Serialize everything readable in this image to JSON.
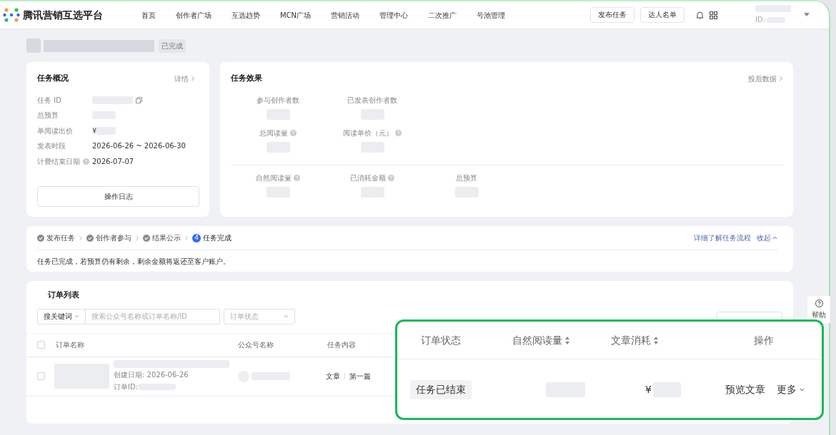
{
  "nav": {
    "logo": "腾讯营销互选平台",
    "items": [
      "首页",
      "创作者广场",
      "互选趋势",
      "MCN广场",
      "营销活动",
      "管理中心",
      "二次推广",
      "号池管理"
    ],
    "buttons": [
      "发布任务",
      "达人名单"
    ],
    "id_label": "ID:"
  },
  "page_header": {
    "status": "已完成"
  },
  "overview": {
    "title": "任务概况",
    "link": "详情",
    "rows": [
      {
        "label": "任务 ID",
        "kind": "id",
        "help": false
      },
      {
        "label": "总预算",
        "kind": "blurred",
        "help": false
      },
      {
        "label": "单阅读出价",
        "kind": "price",
        "symbol": "¥",
        "help": false
      },
      {
        "label": "发表时段",
        "kind": "text",
        "value": "2026-06-26 ~ 2026-06-30",
        "help": false
      },
      {
        "label": "计费结束日期",
        "kind": "text",
        "value": "2026-07-07",
        "help": true
      }
    ],
    "button": "操作日志"
  },
  "effect": {
    "title": "任务效果",
    "link": "投后数据",
    "groups": [
      [
        {
          "label": "参与创作者数",
          "help": false
        },
        {
          "label": "已发表创作者数",
          "help": false
        }
      ],
      [
        {
          "label": "总阅读量",
          "help": true
        },
        {
          "label": "阅读单价（元）",
          "help": true
        }
      ],
      [
        {
          "label": "自然阅读量",
          "help": true
        },
        {
          "label": "已消耗金额",
          "help": true
        },
        {
          "label": "总预算",
          "help": false
        }
      ]
    ]
  },
  "steps": {
    "items": [
      {
        "label": "发布任务",
        "done": true
      },
      {
        "label": "创作者参与",
        "done": true
      },
      {
        "label": "结果公示",
        "done": true
      },
      {
        "label": "任务完成",
        "done": false,
        "marker": "4"
      }
    ],
    "links": [
      "详细了解任务流程",
      "收起"
    ],
    "note": "任务已完成，若预算仍有剩余，剩余金额将返还至客户账户。"
  },
  "orders": {
    "title": "订单列表",
    "keyword_select": "搜关键词",
    "search_placeholder": "搜索公众号名称或订单名称/ID",
    "status_placeholder": "订单状态",
    "columns": [
      "订单名称",
      "公众号名称",
      "任务内容"
    ],
    "all_checked": false,
    "rows": [
      {
        "checked": false,
        "created": "创建日期: 2026-06-26",
        "order_id_label": "订单ID:",
        "content_type": "文章",
        "content_position": "第一篇"
      }
    ]
  },
  "callout": {
    "columns": [
      {
        "label": "订单状态",
        "sortable": false
      },
      {
        "label": "自然阅读量",
        "sortable": true
      },
      {
        "label": "文章消耗",
        "sortable": true
      },
      {
        "label": "操作",
        "sortable": false
      }
    ],
    "status": "任务已结束",
    "price_symbol": "¥",
    "action": "预览文章",
    "more": "更多"
  },
  "help_button": "帮助"
}
